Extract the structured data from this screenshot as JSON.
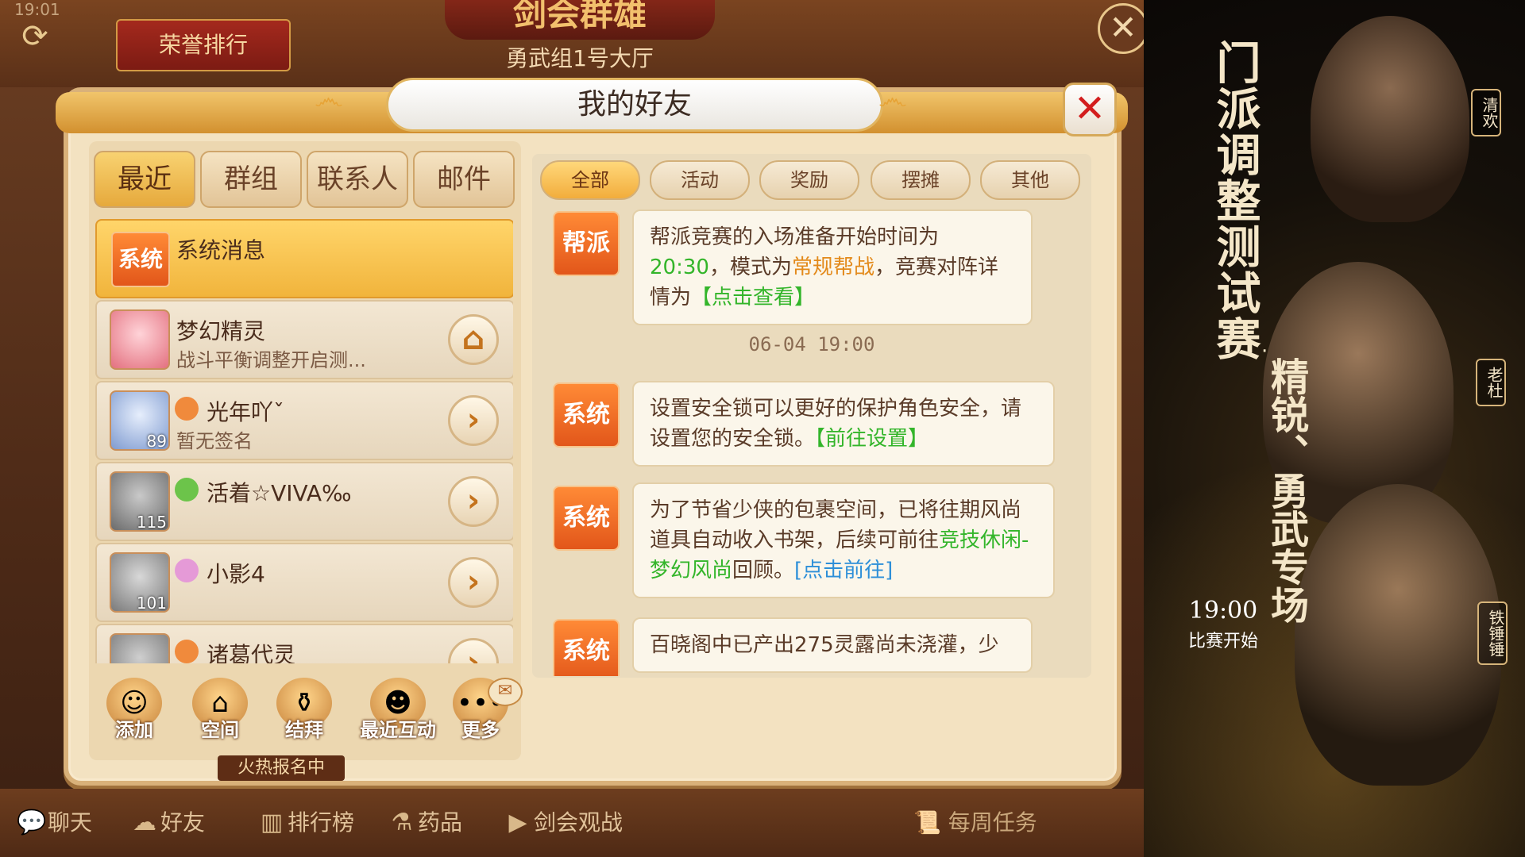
{
  "clock": "19:01",
  "top": {
    "honor_tab": "荣誉排行",
    "arena_title": "剑会群雄",
    "hall_name": "勇武组1号大厅"
  },
  "dialog": {
    "title": "我的好友",
    "tabs": [
      "最近",
      "群组",
      "联系人",
      "邮件"
    ],
    "active_tab": "最近",
    "contacts": [
      {
        "name": "系统消息",
        "badge": "系统",
        "signature": "",
        "selected": true
      },
      {
        "name": "梦幻精灵",
        "signature": "战斗平衡调整开启测...",
        "button": "home-icon"
      },
      {
        "name": "光年吖ˇ",
        "level": "89",
        "signature": "暂无签名",
        "button": "arrow-right-icon"
      },
      {
        "name": "活着☆VIVA‰",
        "level": "115",
        "signature": "",
        "button": "arrow-right-icon"
      },
      {
        "name": "小影4",
        "level": "101",
        "signature": "",
        "button": "arrow-right-icon"
      },
      {
        "name": "诸葛代灵",
        "level": "",
        "signature": "",
        "button": "arrow-right-icon"
      }
    ],
    "actions": [
      "添加",
      "空间",
      "结拜",
      "最近互动",
      "更多"
    ],
    "hot_banner": "火热报名中",
    "filters": [
      "全部",
      "活动",
      "奖励",
      "摆摊",
      "其他"
    ],
    "active_filter": "全部",
    "messages": [
      {
        "badge": "帮派",
        "parts": [
          {
            "t": "帮派竞赛的入场准备开始时间为",
            "c": ""
          },
          {
            "t": "20:30",
            "c": "g"
          },
          {
            "t": "，模式为",
            "c": ""
          },
          {
            "t": "常规帮战",
            "c": "o"
          },
          {
            "t": "，竞赛对阵详情为",
            "c": ""
          },
          {
            "t": "【点击查看】",
            "c": "g"
          }
        ]
      },
      {
        "time": "06-04 19:00"
      },
      {
        "badge": "系统",
        "parts": [
          {
            "t": "设置安全锁可以更好的保护角色安全，请设置您的安全锁。",
            "c": ""
          },
          {
            "t": "【前往设置】",
            "c": "g"
          }
        ]
      },
      {
        "badge": "系统",
        "parts": [
          {
            "t": "为了节省少侠的包裹空间，已将往期风尚道具自动收入书架，后续可前往",
            "c": ""
          },
          {
            "t": "竞技休闲-梦幻风尚",
            "c": "g"
          },
          {
            "t": "回顾。",
            "c": ""
          },
          {
            "t": "[点击前往]",
            "c": "b"
          }
        ]
      },
      {
        "badge": "系统",
        "parts": [
          {
            "t": "百晓阁中已产出275灵露尚未浇灌，少",
            "c": ""
          }
        ]
      }
    ]
  },
  "bottom_bar": [
    "聊天",
    "好友",
    "排行榜",
    "药品",
    "剑会观战"
  ],
  "weekly_task": "每周任务",
  "promo": {
    "title": "门派调整测试赛",
    "subtitle": "精锐、勇武专场",
    "time": "19:00",
    "start": "比赛开始",
    "names": [
      "清欢",
      "老杜",
      "铁锤锤"
    ]
  }
}
